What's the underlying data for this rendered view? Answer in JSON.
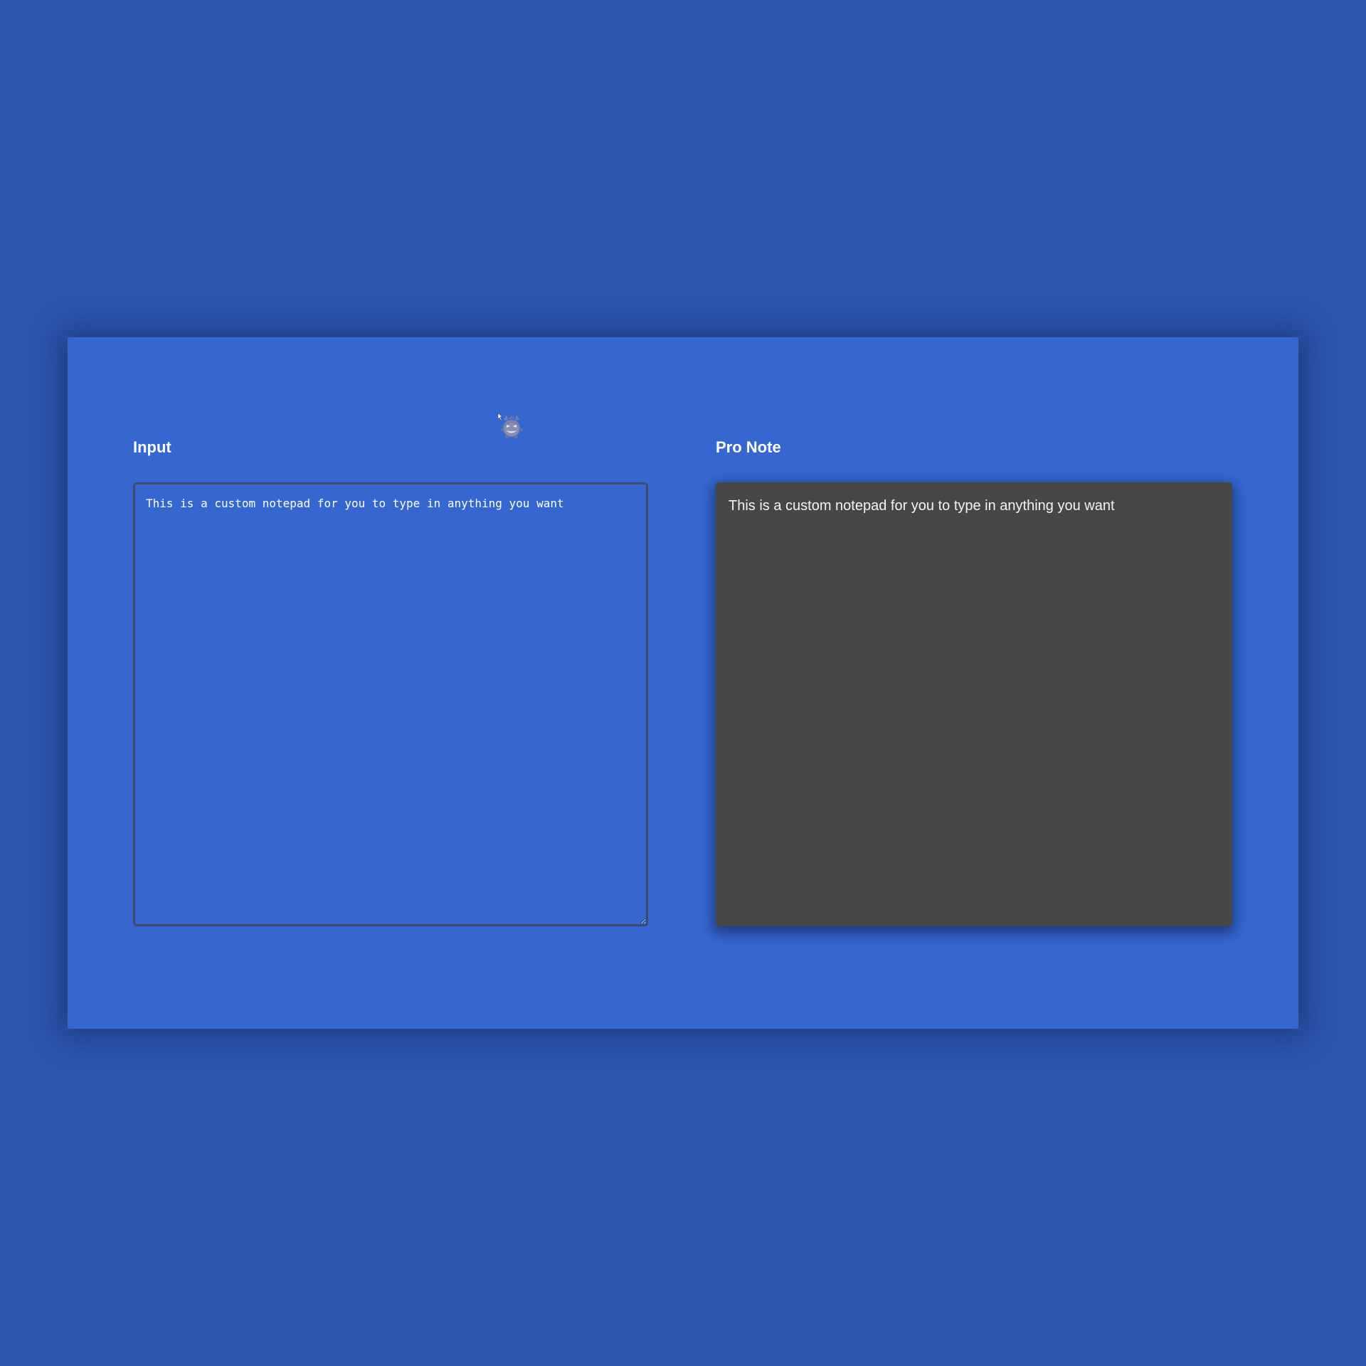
{
  "input_panel": {
    "title": "Input",
    "value": "This is a custom notepad for you to type in anything you want"
  },
  "note_panel": {
    "title": "Pro Note",
    "content": "This is a custom notepad for you to type in anything you want"
  },
  "colors": {
    "page_background": "#2e57b0",
    "card_background": "#3667d0",
    "note_background": "#474747",
    "input_border": "#3f4b6a",
    "text": "#ffffff"
  },
  "icons": {
    "mascot": "gengar-sprite-icon"
  }
}
